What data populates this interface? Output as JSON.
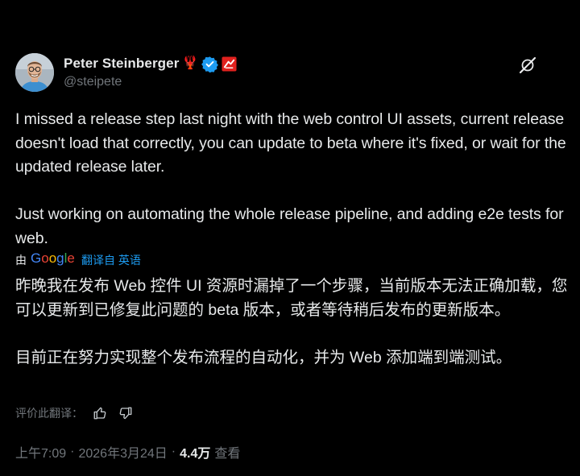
{
  "author": {
    "display_name": "Peter Steinberger",
    "handle": "@steipete",
    "badge_emoji": "🦞",
    "verified_color": "#1d9bf0"
  },
  "tweet": {
    "text": "I missed a release step last night with the web control UI assets, current release doesn't load that correctly, you can update to beta where it's fixed, or wait for the updated release later.\n\nJust working on automating the whole release pipeline, and adding e2e tests for web."
  },
  "translation": {
    "by_label": "由",
    "google_logo": "Google",
    "translated_from_label": "翻译自 英语",
    "text": "昨晚我在发布 Web 控件 UI 资源时漏掉了一个步骤，当前版本无法正确加载，您可以更新到已修复此问题的 beta 版本，或者等待稍后发布的更新版本。\n\n目前正在努力实现整个发布流程的自动化，并为 Web 添加端到端测试。",
    "rate_label": "评价此翻译："
  },
  "meta": {
    "time": "上午7:09",
    "date": "2026年3月24日",
    "views_count": "4.4万",
    "views_label": "查看",
    "separator": "·"
  },
  "icons": {
    "grok": "grok-icon",
    "thumbs_up": "thumbs-up-icon",
    "thumbs_down": "thumbs-down-icon",
    "verified": "verified-badge-icon",
    "affiliate": "affiliate-badge-icon"
  },
  "colors": {
    "background": "#000000",
    "text_primary": "#e7e9ea",
    "text_secondary": "#71767b",
    "link": "#1d9bf0",
    "google_blue": "#4285f4",
    "google_red": "#ea4335",
    "google_yellow": "#fbbc05",
    "google_green": "#34a853"
  }
}
